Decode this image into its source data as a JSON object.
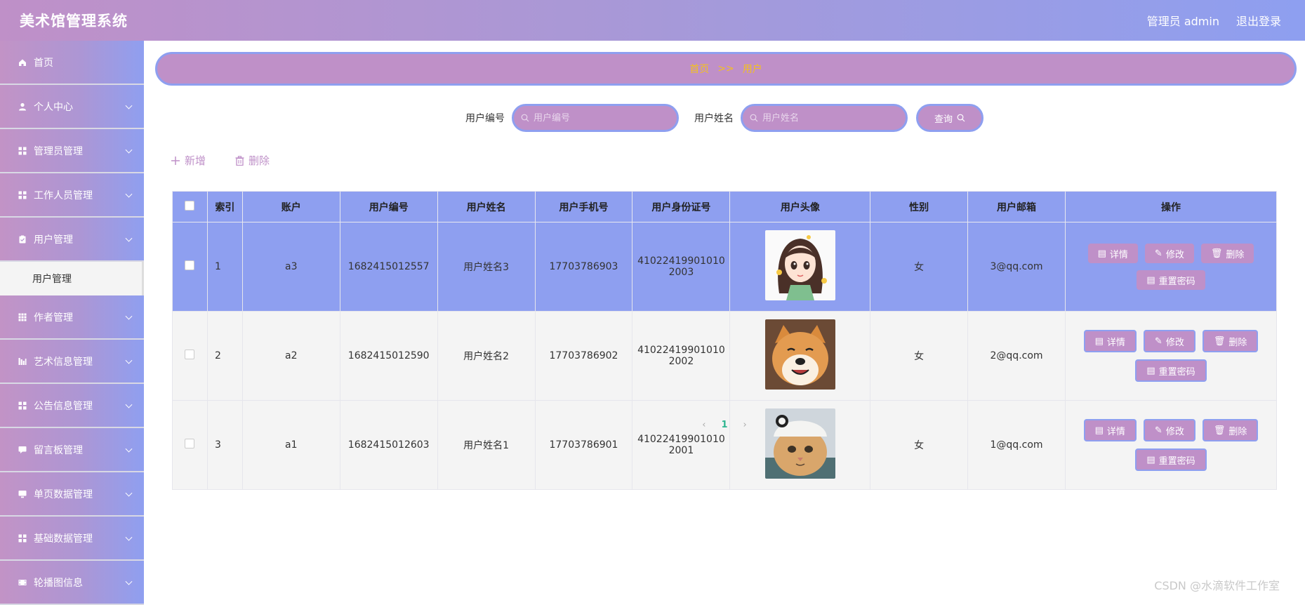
{
  "app": {
    "title": "美术馆管理系统"
  },
  "header": {
    "user": "管理员 admin",
    "logout": "退出登录"
  },
  "sidebar": {
    "items": [
      {
        "label": "首页",
        "icon": "home-icon",
        "submenu": false
      },
      {
        "label": "个人中心",
        "icon": "user-icon",
        "submenu": true
      },
      {
        "label": "管理员管理",
        "icon": "grid-icon",
        "submenu": true
      },
      {
        "label": "工作人员管理",
        "icon": "grid-icon",
        "submenu": true
      },
      {
        "label": "用户管理",
        "icon": "clipboard-icon",
        "submenu": true
      },
      {
        "label": "作者管理",
        "icon": "apps-icon",
        "submenu": true
      },
      {
        "label": "艺术信息管理",
        "icon": "bar-chart-icon",
        "submenu": true
      },
      {
        "label": "公告信息管理",
        "icon": "grid-icon",
        "submenu": true
      },
      {
        "label": "留言板管理",
        "icon": "message-icon",
        "submenu": true
      },
      {
        "label": "单页数据管理",
        "icon": "monitor-icon",
        "submenu": true
      },
      {
        "label": "基础数据管理",
        "icon": "grid-icon",
        "submenu": true
      },
      {
        "label": "轮播图信息",
        "icon": "film-icon",
        "submenu": true
      }
    ],
    "active_sub": "用户管理"
  },
  "breadcrumb": {
    "home": "首页",
    "sep": ">>",
    "current": "用户"
  },
  "search": {
    "user_no_label": "用户编号",
    "user_no_placeholder": "用户编号",
    "user_name_label": "用户姓名",
    "user_name_placeholder": "用户姓名",
    "query_label": "查询"
  },
  "actions": {
    "add": "新增",
    "delete": "删除"
  },
  "table": {
    "headers": [
      "索引",
      "账户",
      "用户编号",
      "用户姓名",
      "用户手机号",
      "用户身份证号",
      "用户头像",
      "性别",
      "用户邮箱",
      "操作"
    ],
    "rows": [
      {
        "index": "1",
        "account": "a3",
        "no": "1682415012557",
        "name": "用户姓名3",
        "phone": "17703786903",
        "idcard_1": "41022419901010",
        "idcard_2": "2003",
        "gender": "女",
        "email": "3@qq.com",
        "avatar": "girl-avatar"
      },
      {
        "index": "2",
        "account": "a2",
        "no": "1682415012590",
        "name": "用户姓名2",
        "phone": "17703786902",
        "idcard_1": "41022419901010",
        "idcard_2": "2002",
        "gender": "女",
        "email": "2@qq.com",
        "avatar": "dog-avatar"
      },
      {
        "index": "3",
        "account": "a1",
        "no": "1682415012603",
        "name": "用户姓名1",
        "phone": "17703786901",
        "idcard_1": "41022419901010",
        "idcard_2": "2001",
        "gender": "女",
        "email": "1@qq.com",
        "avatar": "cat-avatar"
      }
    ],
    "ops": {
      "detail": "详情",
      "edit": "修改",
      "delete": "删除",
      "reset": "重置密码"
    }
  },
  "pager": {
    "prev": "‹",
    "page": "1",
    "next": "›"
  },
  "watermark": "CSDN @水滴软件工作室",
  "colors": {
    "purple": "#bf90c8",
    "blue": "#8e9ff0",
    "gold": "#f3c020"
  }
}
